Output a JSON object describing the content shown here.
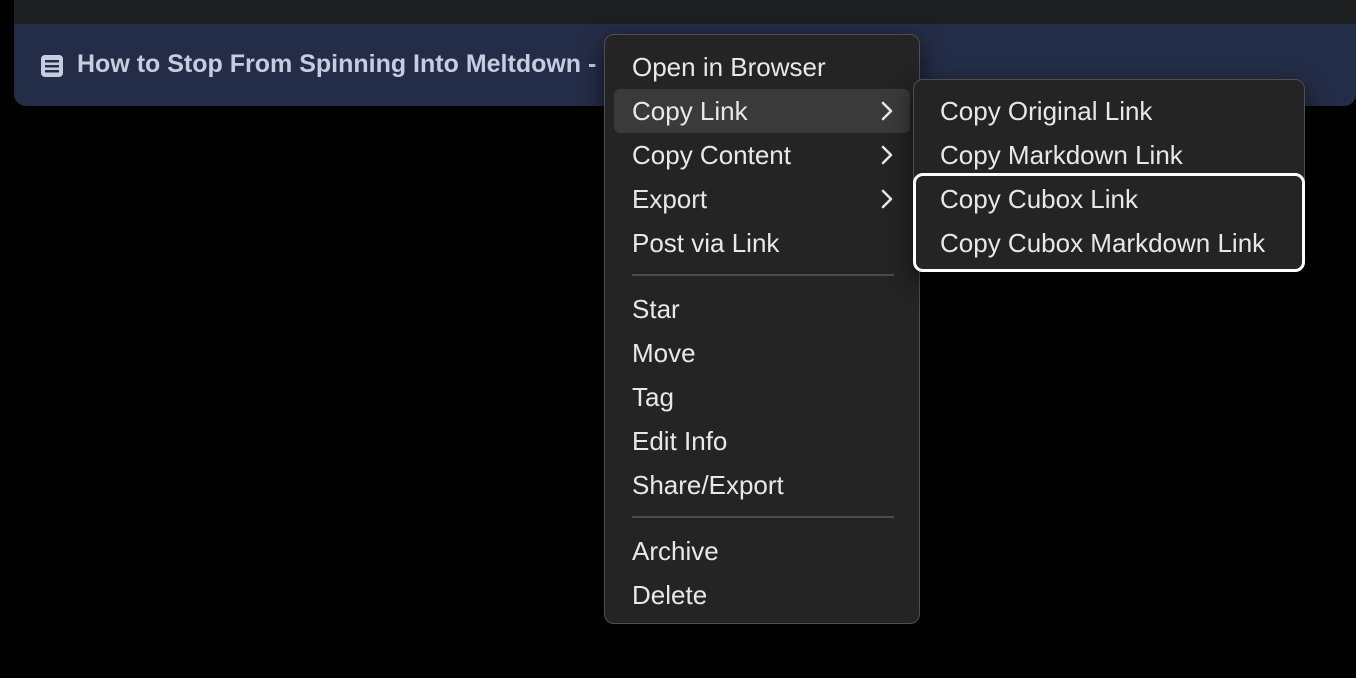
{
  "article": {
    "title": "How to Stop From Spinning Into Meltdown - Mindful",
    "icon": "article-icon"
  },
  "menu": {
    "items": [
      {
        "label": "Open in Browser",
        "has_submenu": false
      },
      {
        "label": "Copy Link",
        "has_submenu": true,
        "active": true
      },
      {
        "label": "Copy Content",
        "has_submenu": true
      },
      {
        "label": "Export",
        "has_submenu": true
      },
      {
        "label": "Post via Link",
        "has_submenu": false
      },
      {
        "label": "Star",
        "has_submenu": false
      },
      {
        "label": "Move",
        "has_submenu": false
      },
      {
        "label": "Tag",
        "has_submenu": false
      },
      {
        "label": "Edit Info",
        "has_submenu": false
      },
      {
        "label": "Share/Export",
        "has_submenu": false
      },
      {
        "label": "Archive",
        "has_submenu": false
      },
      {
        "label": "Delete",
        "has_submenu": false
      }
    ]
  },
  "submenu": {
    "items": [
      {
        "label": "Copy Original Link"
      },
      {
        "label": "Copy Markdown Link"
      },
      {
        "label": "Copy Cubox Link"
      },
      {
        "label": "Copy Cubox Markdown Link"
      }
    ]
  },
  "colors": {
    "background": "#000000",
    "article_bar": "#242d47",
    "menu_bg": "#242424",
    "highlight": "#ffffff"
  }
}
